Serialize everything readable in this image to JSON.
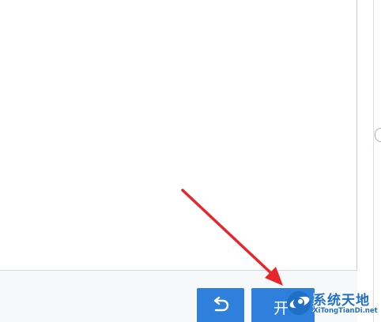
{
  "footer": {
    "back_button_icon": "undo-arrow-icon",
    "start_button_label": "开",
    "button_color": "#2f7fdc"
  },
  "annotation": {
    "arrow_color": "#e8262a",
    "arrow_icon": "red-pointer-arrow-icon"
  },
  "watermark": {
    "title": "系统天地",
    "subtitle": "XiTongTianDi.net",
    "logo_icon": "globe-logo-icon",
    "color": "#1f6fc4"
  }
}
